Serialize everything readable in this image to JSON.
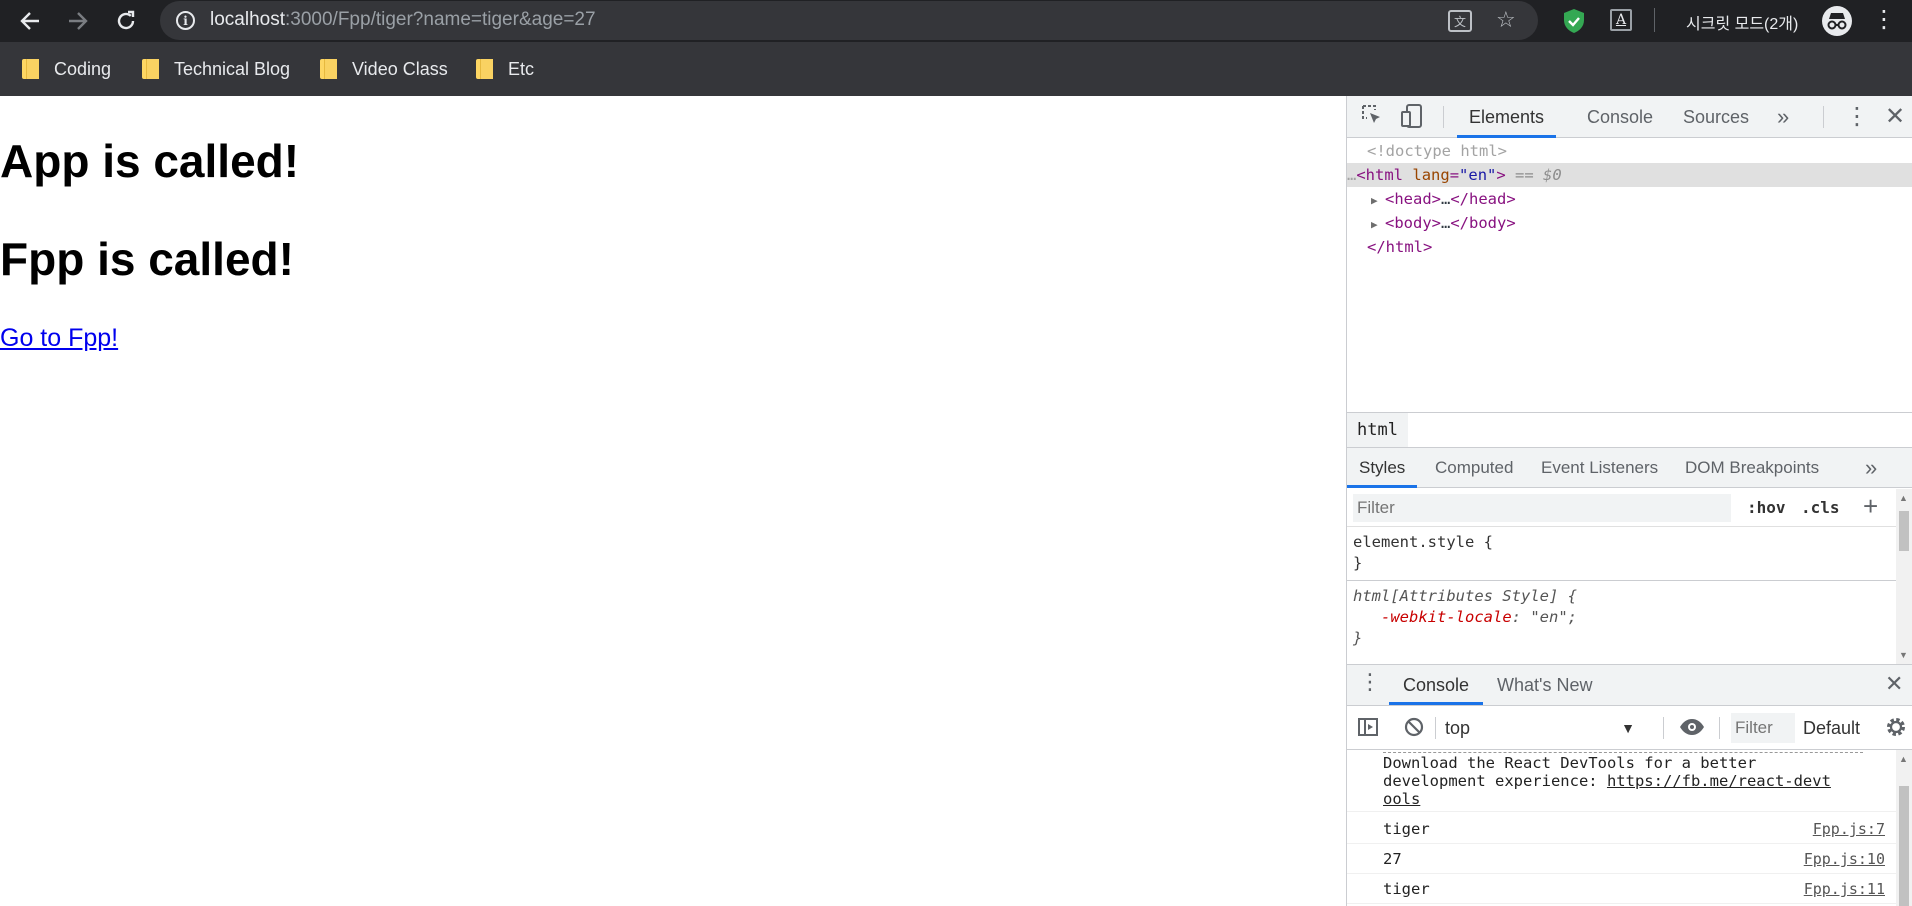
{
  "browser": {
    "url_host": "localhost",
    "url_rest": ":3000/Fpp/tiger?name=tiger&age=27",
    "incognito_label": "시크릿 모드(2개)",
    "icons": [
      "back-arrow-icon",
      "forward-arrow-icon",
      "reload-icon",
      "info-icon",
      "translate-icon",
      "star-icon",
      "shield-extension-icon",
      "a-extension-icon",
      "incognito-icon",
      "kebab-menu-icon"
    ],
    "bookmarks": [
      "Coding",
      "Technical Blog",
      "Video Class",
      "Etc"
    ]
  },
  "page": {
    "heading1": "App is called!",
    "heading2": "Fpp is called!",
    "link": "Go to Fpp!"
  },
  "devtools": {
    "tabs": [
      "Elements",
      "Console",
      "Sources"
    ],
    "more": "»",
    "dom": {
      "doctype": "<!doctype html>",
      "html_open_tag": "<html",
      "html_attr_name": "lang",
      "html_attr_value": "\"en\"",
      "html_close_bracket": ">",
      "dollar0": "== $0",
      "head_open": "<head>",
      "head_ellipsis": "…",
      "head_close": "</head>",
      "body_open": "<body>",
      "body_ellipsis": "…",
      "body_close": "</body>",
      "html_close": "</html>"
    },
    "breadcrumb": "html",
    "styles_tabs": [
      "Styles",
      "Computed",
      "Event Listeners",
      "DOM Breakpoints"
    ],
    "styles_more": "»",
    "filter_placeholder": "Filter",
    "hov": ":hov",
    "cls": ".cls",
    "plus": "+",
    "rule1_selector": "element.style {",
    "rule1_close": "}",
    "rule2_selector": "html[Attributes Style] {",
    "rule2_prop": "-webkit-locale",
    "rule2_value": ": \"en\";",
    "rule2_close": "}",
    "drawer_tabs": [
      "Console",
      "What's New"
    ],
    "console_context": "top",
    "console_filter": "Filter",
    "console_levels": "Default",
    "messages": {
      "m0_line1": "Download the React DevTools for a better",
      "m0_line2a": "development experience: ",
      "m0_link1": "https://fb.me/react-devt",
      "m0_link2": "ools",
      "m1_text": "tiger",
      "m1_src": "Fpp.js:7",
      "m2_text": "27",
      "m2_src": "Fpp.js:10",
      "m3_text": "tiger",
      "m3_src": "Fpp.js:11"
    }
  }
}
